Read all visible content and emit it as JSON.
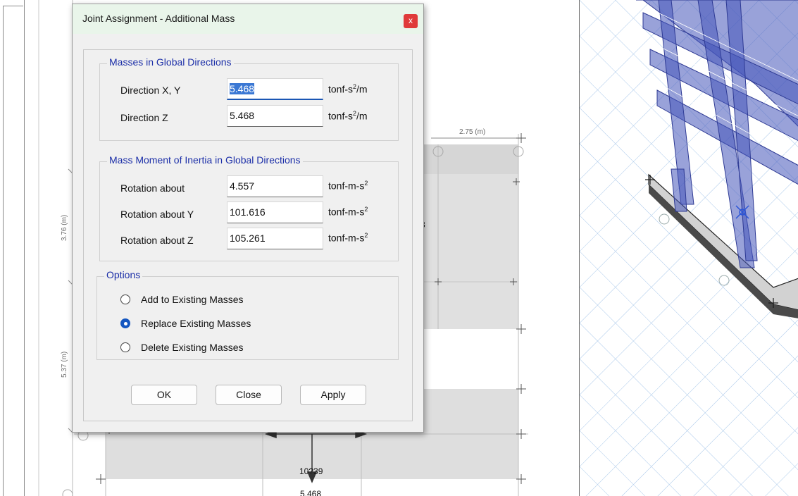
{
  "dialog": {
    "title": "Joint Assignment - Additional Mass",
    "close_glyph": "x",
    "masses_group": {
      "title": "Masses in Global Directions",
      "rows": [
        {
          "label": "Direction  X, Y",
          "value": "5.468",
          "unit_pre": "tonf-s",
          "unit_sup": "2",
          "unit_post": "/m"
        },
        {
          "label": "Direction  Z",
          "value": "5.468",
          "unit_pre": "tonf-s",
          "unit_sup": "2",
          "unit_post": "/m"
        }
      ]
    },
    "inertia_group": {
      "title": "Mass Moment of Inertia in Global Directions",
      "rows": [
        {
          "label": "Rotation about",
          "value": "4.557",
          "unit_pre": "tonf-m-s",
          "unit_sup": "2"
        },
        {
          "label": "Rotation about  Y",
          "value": "101.616",
          "unit_pre": "tonf-m-s",
          "unit_sup": "2"
        },
        {
          "label": "Rotation about  Z",
          "value": "105.261",
          "unit_pre": "tonf-m-s",
          "unit_sup": "2"
        }
      ]
    },
    "options_group": {
      "title": "Options",
      "items": [
        {
          "label": "Add to Existing Masses",
          "selected": false
        },
        {
          "label": "Replace Existing Masses",
          "selected": true
        },
        {
          "label": "Delete Existing Masses",
          "selected": false
        }
      ]
    },
    "buttons": {
      "ok": "OK",
      "close": "Close",
      "apply": "Apply"
    }
  },
  "plan_view": {
    "dim_top": "2.75 (m)",
    "dim_left_1": "3.76 (m)",
    "dim_left_2": "5.37 (m)",
    "label_joint": "10?39",
    "label_mass": "5.468",
    "label_side": "3"
  },
  "colors": {
    "accent": "#1456c0",
    "group_title": "#1c2fa8",
    "titlebar": "#e9f5ea",
    "close_button": "#e03a3a",
    "frame_blue": "#3f4fb0"
  }
}
